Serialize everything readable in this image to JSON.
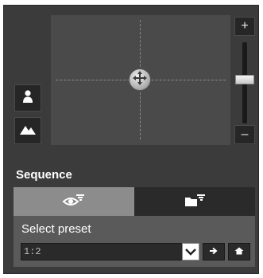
{
  "zoom": {
    "in_label": "+",
    "out_label": "–",
    "level": 0.45
  },
  "sequence": {
    "title": "Sequence",
    "select_preset_label": "Select preset",
    "preset_value": "1:2"
  },
  "icons": {
    "person": "person-icon",
    "landscape": "landscape-icon",
    "move": "move-icon",
    "eye": "eye-icon",
    "folder": "folder-icon",
    "go": "arrow-right-icon",
    "home": "home-icon"
  }
}
